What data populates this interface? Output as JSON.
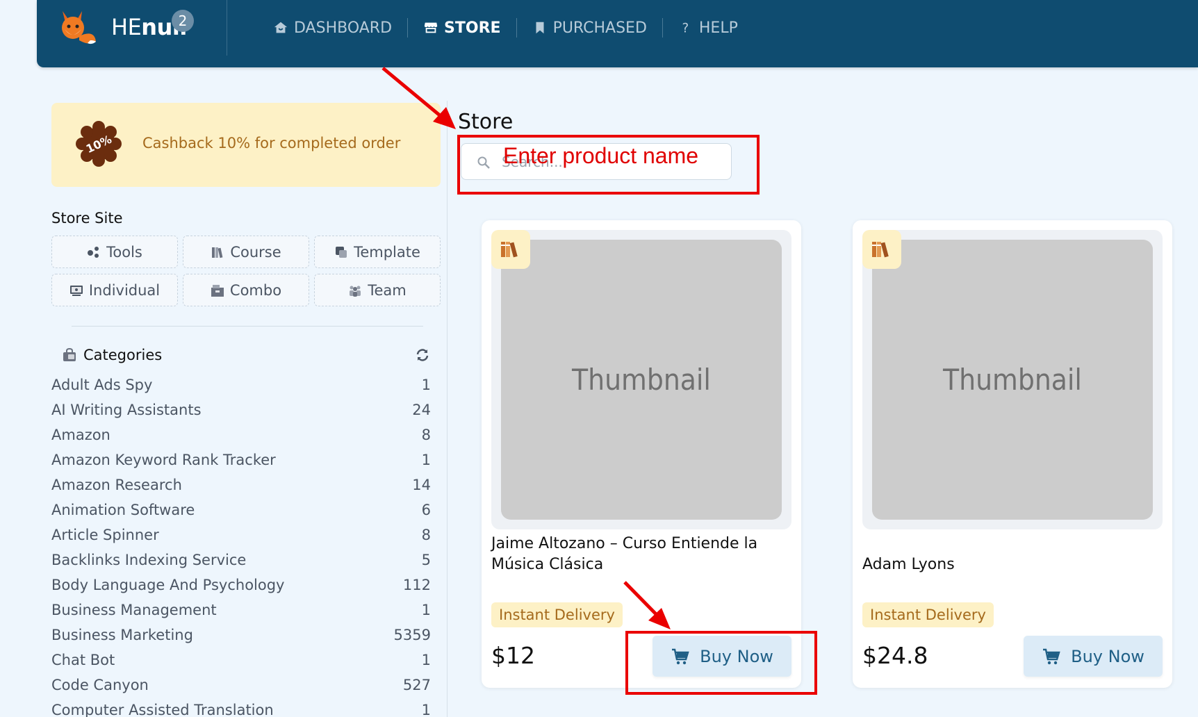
{
  "app": {
    "brand_prefix": "HE",
    "brand_bold": "null",
    "brand_badge": "2"
  },
  "nav": {
    "items": [
      {
        "label": "DASHBOARD",
        "icon": "home-icon",
        "active": false
      },
      {
        "label": "STORE",
        "icon": "store-icon",
        "active": true
      },
      {
        "label": "PURCHASED",
        "icon": "bookmark-icon",
        "active": false
      },
      {
        "label": "HELP",
        "icon": "question-icon",
        "active": false
      }
    ]
  },
  "sidebar": {
    "cashback_badge": "10%",
    "cashback_text": "Cashback 10% for completed order",
    "store_site_title": "Store Site",
    "site_buttons": [
      {
        "label": "Tools",
        "icon": "tools-icon"
      },
      {
        "label": "Course",
        "icon": "books-icon"
      },
      {
        "label": "Template",
        "icon": "template-icon"
      },
      {
        "label": "Individual",
        "icon": "individual-icon"
      },
      {
        "label": "Combo",
        "icon": "combo-icon"
      },
      {
        "label": "Team",
        "icon": "team-icon"
      }
    ],
    "categories_title": "Categories",
    "categories": [
      {
        "name": "Adult Ads Spy",
        "count": "1"
      },
      {
        "name": "AI Writing Assistants",
        "count": "24"
      },
      {
        "name": "Amazon",
        "count": "8"
      },
      {
        "name": "Amazon Keyword Rank Tracker",
        "count": "1"
      },
      {
        "name": "Amazon Research",
        "count": "14"
      },
      {
        "name": "Animation Software",
        "count": "6"
      },
      {
        "name": "Article Spinner",
        "count": "8"
      },
      {
        "name": "Backlinks Indexing Service",
        "count": "5"
      },
      {
        "name": "Body Language And Psychology",
        "count": "112"
      },
      {
        "name": "Business Management",
        "count": "1"
      },
      {
        "name": "Business Marketing",
        "count": "5359"
      },
      {
        "name": "Chat Bot",
        "count": "1"
      },
      {
        "name": "Code Canyon",
        "count": "527"
      },
      {
        "name": "Computer Assisted Translation",
        "count": "1"
      }
    ]
  },
  "main": {
    "title": "Store",
    "search_placeholder": "Search...",
    "annotation_text": "Enter product name",
    "products": [
      {
        "thumb_label": "Thumbnail",
        "title": "Jaime Altozano – Curso Entiende la Música Clásica",
        "badge": "Instant Delivery",
        "price": "$12",
        "buy_label": "Buy Now"
      },
      {
        "thumb_label": "Thumbnail",
        "title": "Adam Lyons",
        "badge": "Instant Delivery",
        "price": "$24.8",
        "buy_label": "Buy Now"
      }
    ]
  },
  "colors": {
    "topbar": "#0f4c70",
    "accent_yellow": "#fdf1c6",
    "annotation_red": "#ea0000"
  }
}
